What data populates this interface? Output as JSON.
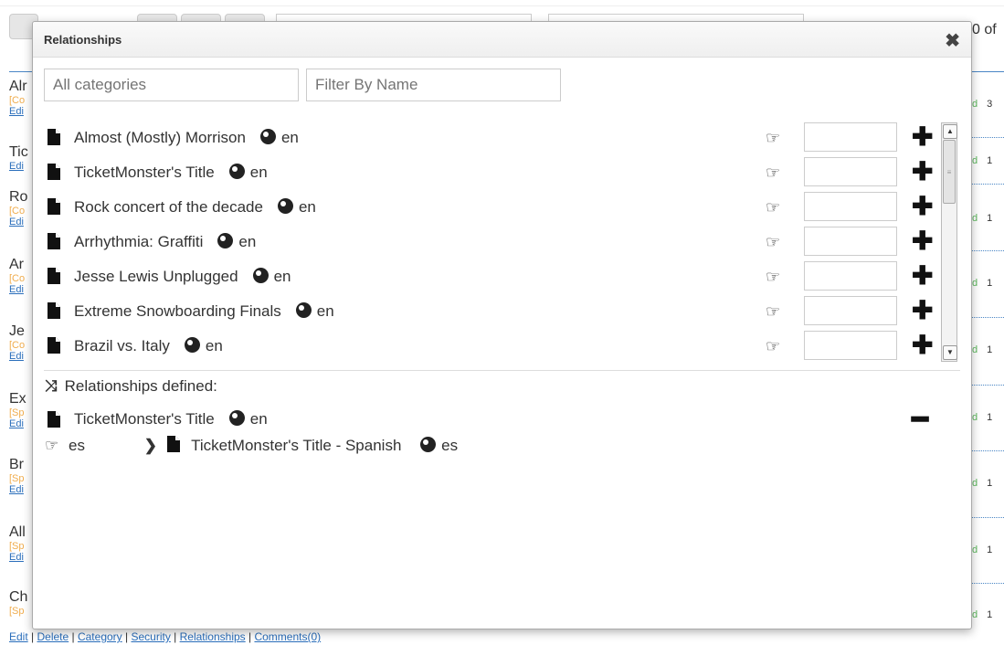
{
  "background": {
    "count_text": "0 of",
    "items": [
      {
        "title": "Alr",
        "tag": "[Co",
        "edit": "Edi",
        "status": "d",
        "count": "3"
      },
      {
        "title": "Tic",
        "tag": "",
        "edit": "Edi",
        "status": "d",
        "count": "1"
      },
      {
        "title": "Ro",
        "tag": "[Co",
        "edit": "Edi",
        "status": "d",
        "count": "1"
      },
      {
        "title": "Ar",
        "tag": "[Co",
        "edit": "Edi",
        "status": "d",
        "count": "1"
      },
      {
        "title": "Je",
        "tag": "[Co",
        "edit": "Edi",
        "status": "d",
        "count": "1"
      },
      {
        "title": "Ex",
        "tag": "[Sp",
        "edit": "Edi",
        "status": "d",
        "count": "1"
      },
      {
        "title": "Br",
        "tag": "[Sp",
        "edit": "Edi",
        "status": "d",
        "count": "1"
      },
      {
        "title": "All",
        "tag": "[Sp",
        "edit": "Edi",
        "status": "d",
        "count": "1"
      },
      {
        "title": "Ch",
        "tag": "[Sp",
        "edit": "",
        "status": "d",
        "count": "1"
      }
    ],
    "footer": {
      "edit": "Edit",
      "delete": "Delete",
      "category": "Category",
      "security": "Security",
      "relationships": "Relationships",
      "comments": "Comments(0)"
    }
  },
  "dialog": {
    "title": "Relationships",
    "close": "✖",
    "category_filter": {
      "placeholder": "All categories"
    },
    "name_filter": {
      "placeholder": "Filter By Name"
    },
    "rows": [
      {
        "name": "Almost (Mostly) Morrison",
        "lang": "en"
      },
      {
        "name": "TicketMonster's Title",
        "lang": "en"
      },
      {
        "name": "Rock concert of the decade",
        "lang": "en"
      },
      {
        "name": "Arrhythmia: Graffiti",
        "lang": "en"
      },
      {
        "name": "Jesse Lewis Unplugged",
        "lang": "en"
      },
      {
        "name": "Extreme Snowboarding Finals",
        "lang": "en"
      },
      {
        "name": "Brazil vs. Italy",
        "lang": "en"
      }
    ],
    "add_symbol": "✚",
    "pointer_symbol": "☞",
    "relationships_header": "Relationships defined:",
    "shuffle_symbol": "⤨",
    "defined": {
      "name": "TicketMonster's Title",
      "lang": "en",
      "remove_symbol": "━"
    },
    "mapping": {
      "lang_code": "es",
      "chevron": "❯",
      "target": "TicketMonster's Title - Spanish",
      "target_lang": "es"
    }
  }
}
